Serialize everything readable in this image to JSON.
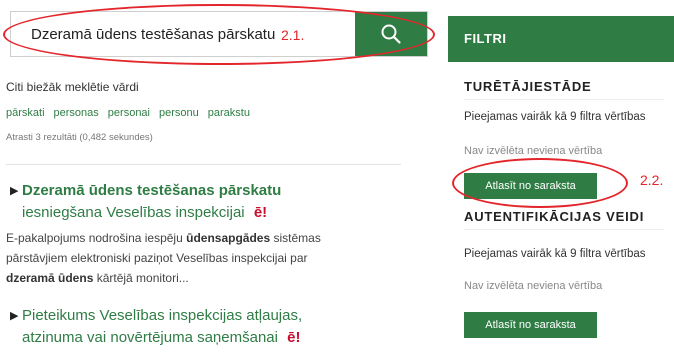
{
  "search": {
    "value": "Dzeramā ūdens testēšanas pārskatu",
    "button_icon": "search-icon"
  },
  "annotations": {
    "search_label": "2.1.",
    "button_label": "2.2."
  },
  "frequent": {
    "label": "Citi biežāk meklētie vārdi",
    "tags": [
      "pārskati",
      "personas",
      "personai",
      "personu",
      "parakstu"
    ]
  },
  "result_count": "Atrasti 3 rezultāti (0,482 sekundes)",
  "results": [
    {
      "title_bold": "Dzeramā ūdens testēšanas pārskatu",
      "title_rest": " iesniegšana Veselības inspekcijai",
      "badge": "ē!",
      "snippet_1": "E-pakalpojums nodrošina iespēju ",
      "snippet_b1": "ūdensapgādes",
      "snippet_2": " sistēmas pārstāvjiem elektroniski paziņot Veselības inspekcijai par ",
      "snippet_b2": "dzeramā ūdens",
      "snippet_3": " kārtējā monitori..."
    },
    {
      "title": "Pieteikums Veselības inspekcijas atļaujas, atzinuma vai novērtējuma saņemšanai",
      "badge": "ē!"
    }
  ],
  "filters": {
    "header": "FILTRI",
    "groups": [
      {
        "title": "TURĒTĀJIESTĀDE",
        "info": "Pieejamas vairāk kā 9 filtra vērtības",
        "empty": "Nav izvēlēta neviena vērtība",
        "button": "Atlasīt no saraksta"
      },
      {
        "title": "AUTENTIFIKĀCIJAS VEIDI",
        "info": "Pieejamas vairāk kā 9 filtra vērtības",
        "empty": "Nav izvēlēta neviena vērtība",
        "button": "Atlasīt no saraksta"
      }
    ]
  },
  "colors": {
    "brand_green": "#2f7d45",
    "annotation_red": "#e3262b",
    "badge_red": "#c8102e"
  }
}
